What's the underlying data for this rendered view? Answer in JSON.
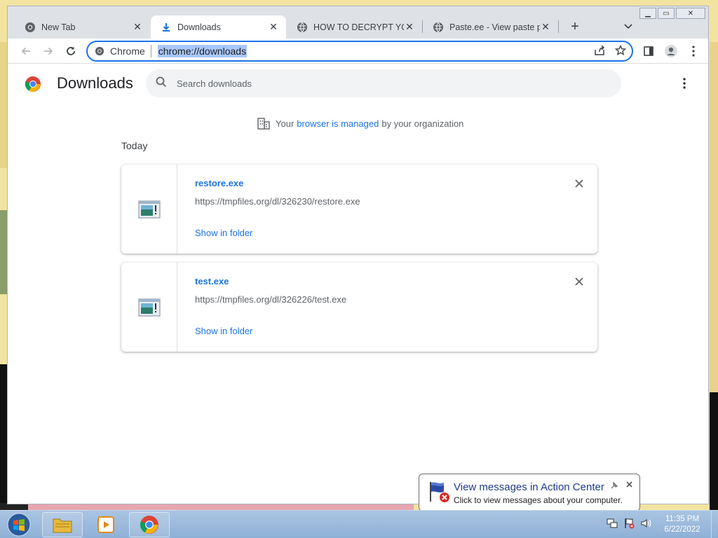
{
  "browser": {
    "tabs": [
      {
        "title": "New Tab",
        "icon": "chrome-icon"
      },
      {
        "title": "Downloads",
        "icon": "download-icon"
      },
      {
        "title": "HOW TO DECRYPT YOUR",
        "icon": "globe-icon"
      },
      {
        "title": "Paste.ee - View paste pl",
        "icon": "globe-icon"
      }
    ],
    "active_tab": 1,
    "omnibox": {
      "chip": "Chrome",
      "url": "chrome://downloads"
    }
  },
  "downloads": {
    "title": "Downloads",
    "search_placeholder": "Search downloads",
    "managed": {
      "prefix": "Your",
      "link": "browser is managed",
      "suffix": "by your organization"
    },
    "group_label": "Today",
    "items": [
      {
        "name": "restore.exe",
        "url": "https://tmpfiles.org/dl/326230/restore.exe",
        "action": "Show in folder"
      },
      {
        "name": "test.exe",
        "url": "https://tmpfiles.org/dl/326226/test.exe",
        "action": "Show in folder"
      }
    ]
  },
  "notification": {
    "title": "View messages in Action Center",
    "message": "Click to view messages about your computer."
  },
  "clock": {
    "time": "11:35 PM",
    "date": "6/22/2022"
  },
  "colors": {
    "accent": "#1a73e8",
    "taskbar": "#8fb0d6"
  }
}
